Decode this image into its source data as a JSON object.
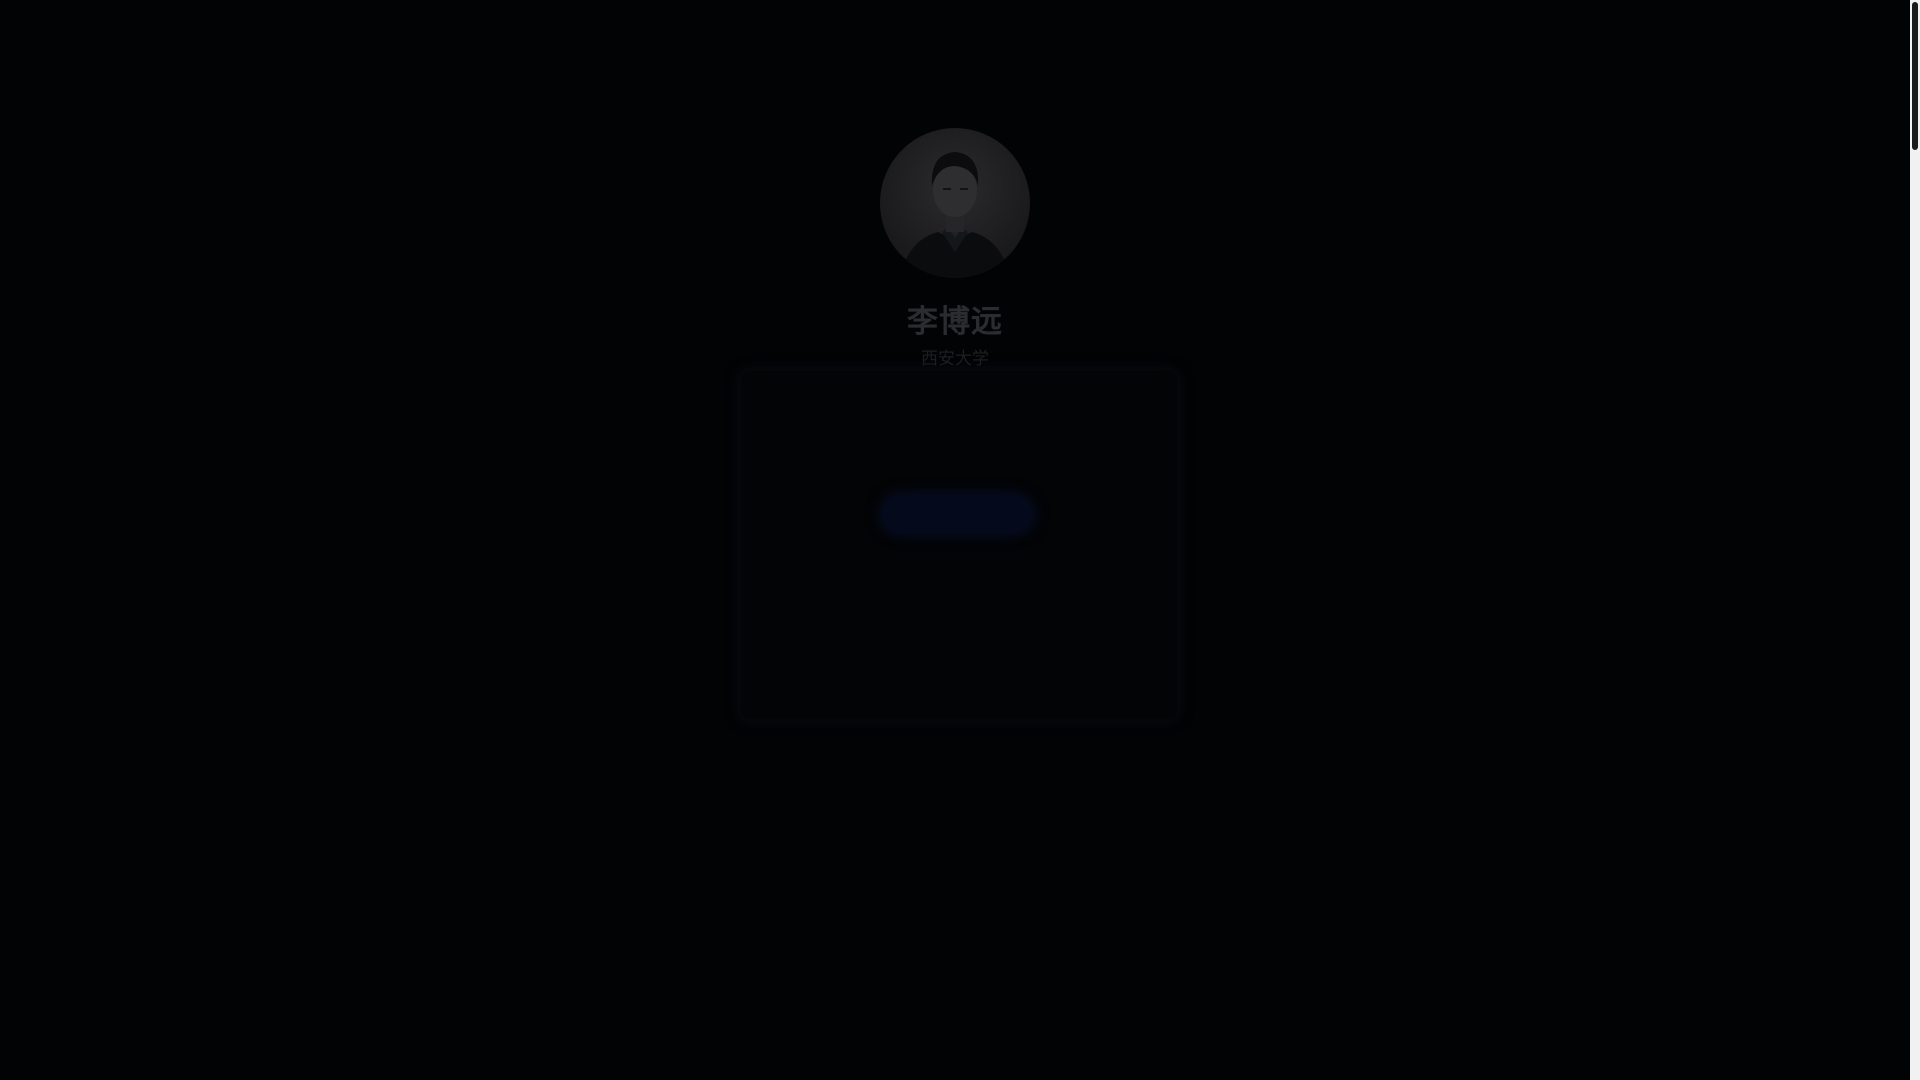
{
  "profile": {
    "name": "李博远",
    "subtitle": "西安大学",
    "avatar_alt": "avatar-photo"
  },
  "card": {
    "line1": "",
    "line2": "",
    "button_label": ""
  },
  "colors": {
    "background": "#020305",
    "accent": "#040a1c"
  }
}
